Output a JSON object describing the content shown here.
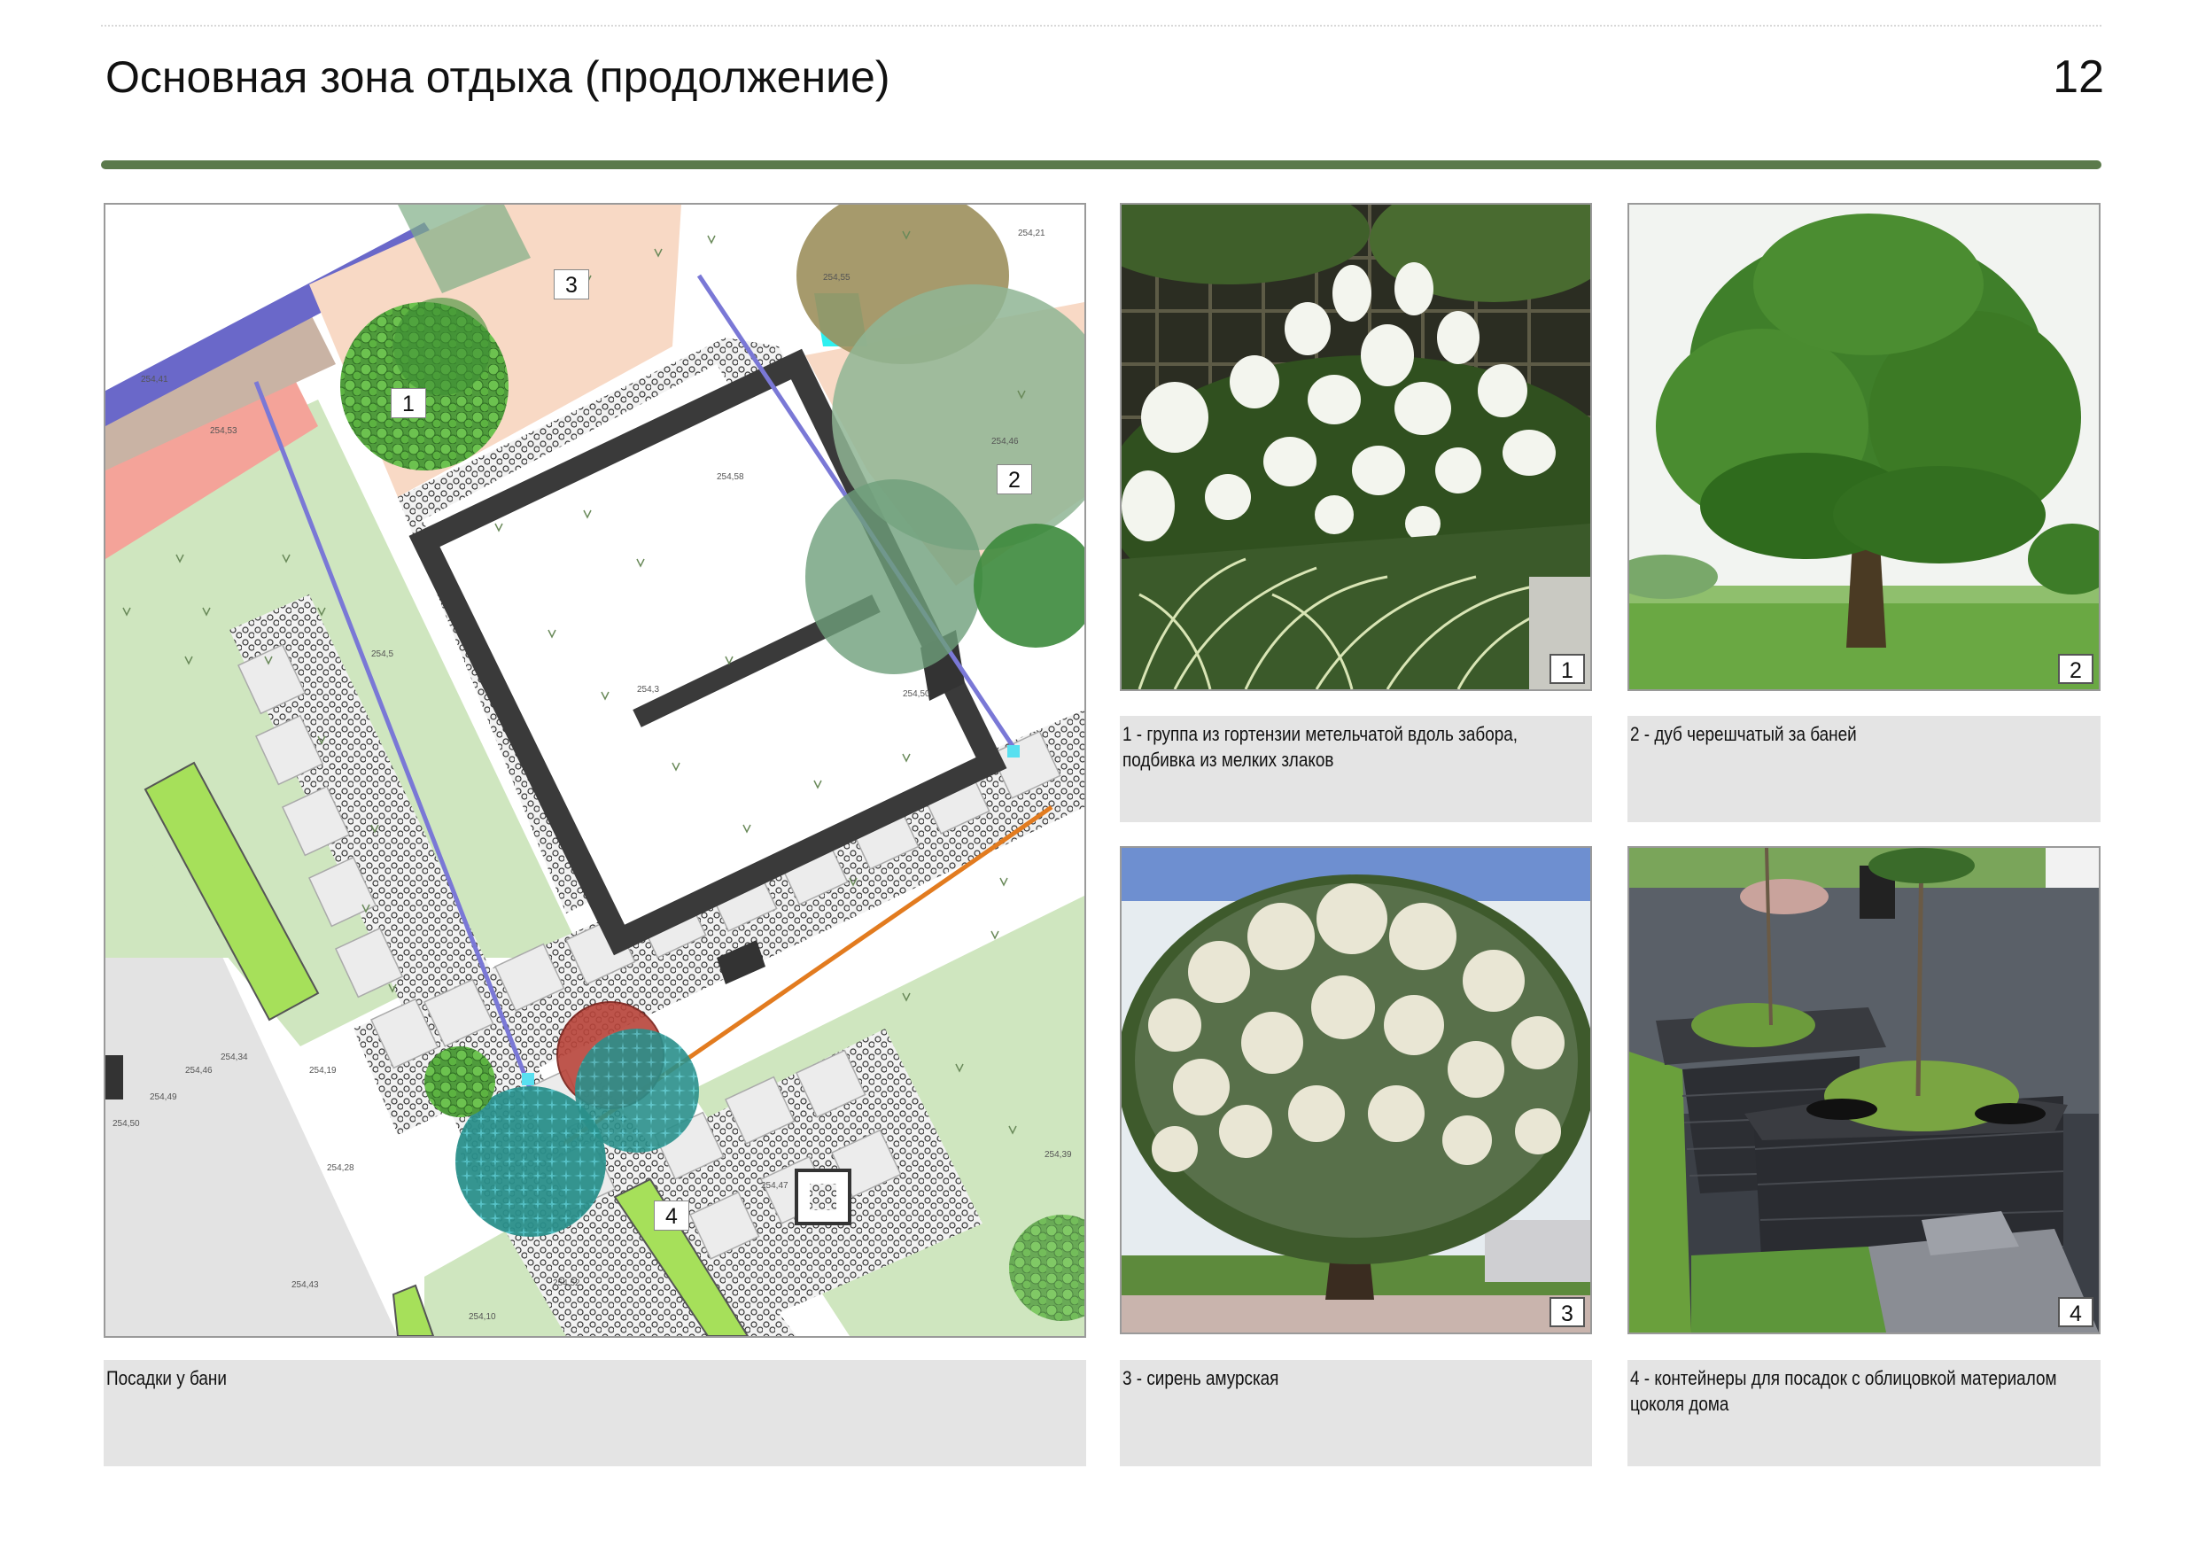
{
  "header": {
    "title": "Основная зона отдыха (продолжение)",
    "page_number": "12"
  },
  "plan": {
    "caption": "Посадки у бани",
    "labels": [
      "1",
      "2",
      "3",
      "4"
    ],
    "elevations": [
      "254,21",
      "254,41",
      "254,53",
      "254,58",
      "254,46",
      "254,50",
      "254,5",
      "254,3",
      "254,34",
      "254,46",
      "254,49",
      "254,50",
      "254,19",
      "254,28",
      "254,43",
      "254,52",
      "254,10",
      "254,39",
      "254,47",
      "254,55"
    ]
  },
  "photos": [
    {
      "number": "1",
      "caption_lines": [
        "1 - группа из гортензии метельчатой вдоль забора,",
        "подбивка из мелких злаков"
      ]
    },
    {
      "number": "2",
      "caption_lines": [
        "2 - дуб черешчатый за баней"
      ]
    },
    {
      "number": "3",
      "caption_lines": [
        "3 - сирень амурская"
      ]
    },
    {
      "number": "4",
      "caption_lines": [
        "4 - контейнеры для посадок с облицовкой материалом",
        "цоколя дома"
      ]
    }
  ],
  "colors": {
    "rule": "#5b7a4b",
    "lawn": "#cfe6bf",
    "paving": "#ececec",
    "building_wall": "#333333",
    "bench_green": "#a6e05a",
    "caption_bg": "#e4e4e4"
  }
}
